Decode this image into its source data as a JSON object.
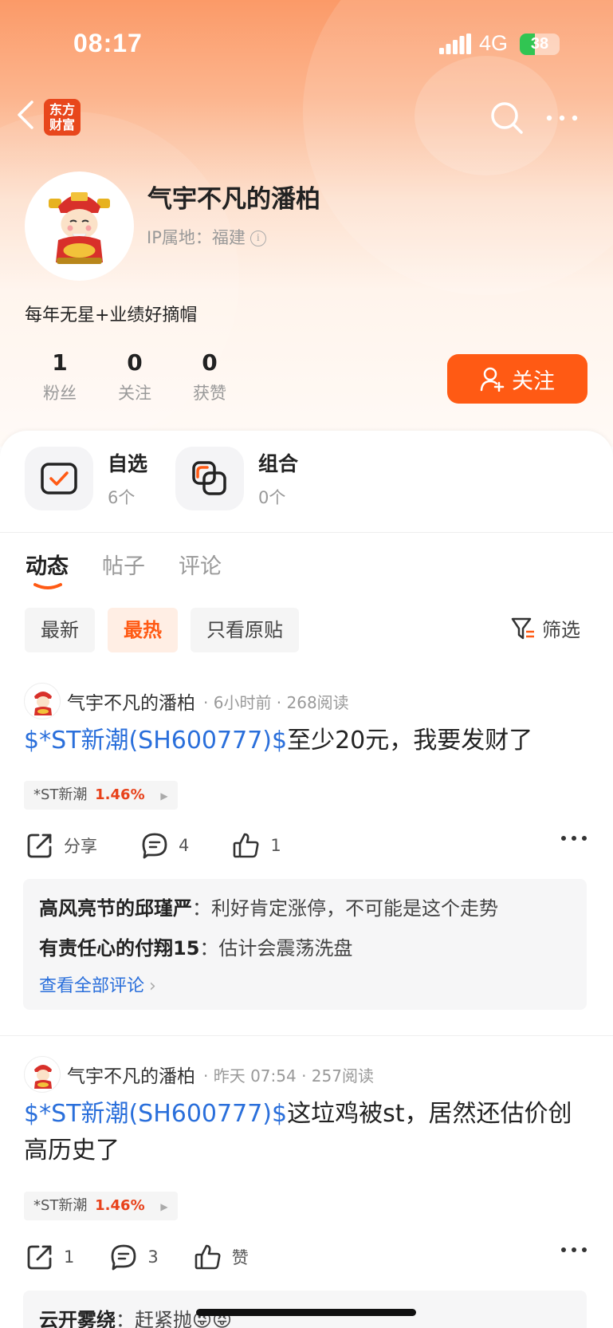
{
  "status_bar": {
    "time": "08:17",
    "network": "4G",
    "battery": "38",
    "battery_level": 0.38
  },
  "header": {
    "logo_text_line1": "东方",
    "logo_text_line2": "财富"
  },
  "profile": {
    "name": "气宇不凡的潘柏",
    "ip_location": "IP属地：福建",
    "bio": "每年无星+业绩好摘帽",
    "stats": [
      {
        "value": "1",
        "label": "粉丝"
      },
      {
        "value": "0",
        "label": "关注"
      },
      {
        "value": "0",
        "label": "获赞"
      }
    ],
    "follow_label": "关注"
  },
  "quick_links": [
    {
      "title": "自选",
      "count": "6个"
    },
    {
      "title": "组合",
      "count": "0个"
    }
  ],
  "tabs": [
    "动态",
    "帖子",
    "评论"
  ],
  "filters": {
    "chips": [
      "最新",
      "最热",
      "只看原贴"
    ],
    "filter_label": "筛选"
  },
  "posts": [
    {
      "author": "气宇不凡的潘柏",
      "meta": "· 6小时前 · 268阅读",
      "stock_link": "$*ST新潮(SH600777)$",
      "text": "至少20元，我要发财了",
      "tag_name": "*ST新潮",
      "tag_change": "1.46%",
      "share_label": "分享",
      "comment_count": "4",
      "like_count": "1",
      "comments": [
        {
          "user": "高风亮节的邱瑾严",
          "sep": "：",
          "text": "利好肯定涨停，不可能是这个走势"
        },
        {
          "user": "有责任心的付翔15",
          "sep": "：",
          "text": "估计会震荡洗盘"
        }
      ],
      "view_all": "查看全部评论"
    },
    {
      "author": "气宇不凡的潘柏",
      "meta": "· 昨天 07:54 · 257阅读",
      "stock_link": "$*ST新潮(SH600777)$",
      "text": "这垃鸡被st，居然还估价创高历史了",
      "tag_name": "*ST新潮",
      "tag_change": "1.46%",
      "share_count": "1",
      "comment_count": "3",
      "like_label": "赞",
      "comments": [
        {
          "user": "云开雾绕",
          "sep": "：",
          "text": "赶紧抛😜😝"
        }
      ]
    }
  ]
}
